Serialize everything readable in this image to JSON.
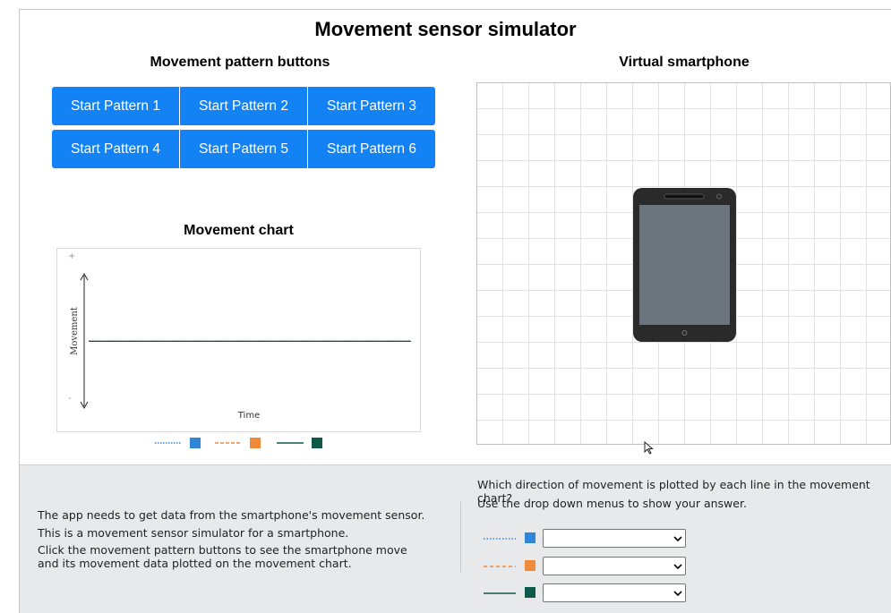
{
  "app": {
    "title": "Movement sensor simulator"
  },
  "buttons_section": {
    "title": "Movement pattern buttons",
    "buttons": [
      "Start Pattern 1",
      "Start Pattern 2",
      "Start Pattern 3",
      "Start Pattern 4",
      "Start Pattern 5",
      "Start Pattern 6"
    ]
  },
  "phone_section": {
    "title": "Virtual smartphone",
    "icon": "smartphone-icon"
  },
  "chart": {
    "title": "Movement chart",
    "y_label": "Movement",
    "x_label": "Time",
    "y_plus": "+",
    "y_minus": "-",
    "chart_data": {
      "type": "line",
      "xlabel": "Time",
      "ylabel": "Movement",
      "series": [
        {
          "color": "#2e86d6",
          "style": "dotted",
          "values": [
            0,
            0
          ]
        },
        {
          "color": "#f08a3b",
          "style": "dashed",
          "values": [
            0,
            0
          ]
        },
        {
          "color": "#0e5a4a",
          "style": "solid",
          "values": [
            0,
            0
          ]
        }
      ],
      "legend": "bottom"
    }
  },
  "colors": {
    "blue": "#2e86d6",
    "orange": "#f08a3b",
    "green": "#0e5a4a",
    "button": "#1282f4"
  },
  "info": {
    "line1": "The app needs to get data from the smartphone's movement sensor.",
    "line2": "This is a movement sensor simulator for a smartphone.",
    "line3": "Click the movement pattern buttons to see the smartphone move and its movement data plotted on the movement chart."
  },
  "question": {
    "line1": "Which direction of movement is plotted by each line in the movement chart?",
    "line2": "Use the drop down menus to show your answer.",
    "answers": [
      {
        "selected": ""
      },
      {
        "selected": ""
      },
      {
        "selected": ""
      }
    ]
  }
}
